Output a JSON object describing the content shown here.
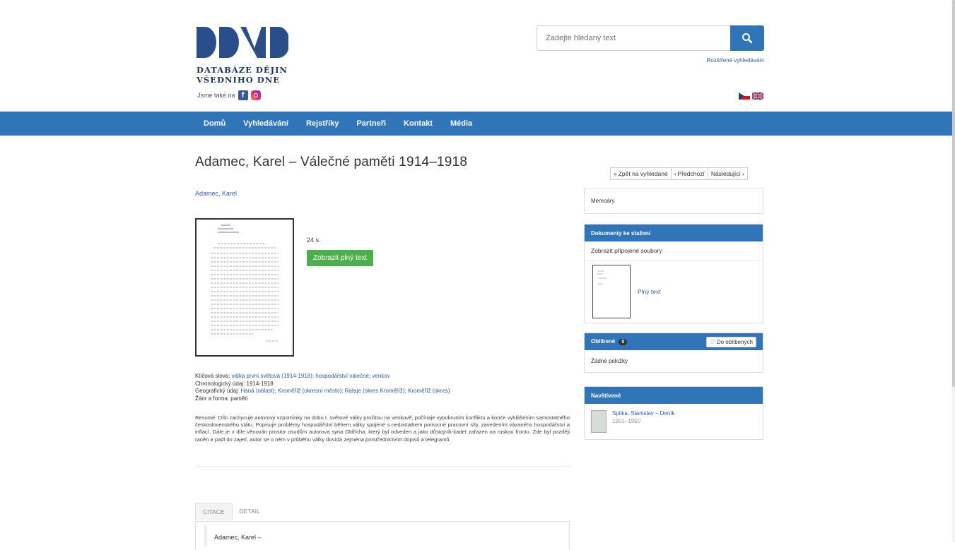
{
  "header": {
    "logo_line1": "DATABÁZE DĚJIN",
    "logo_line2": "VŠEDNÍHO DNE",
    "social_label": "Jsme také na",
    "search_placeholder": "Zadejte hledaný text",
    "advanced_search": "Rozšířené vyhledávání"
  },
  "nav": [
    "Domů",
    "Vyhledávání",
    "Rejstříky",
    "Partneři",
    "Kontakt",
    "Média"
  ],
  "record": {
    "title": "Adamec, Karel – Válečné paměti 1914–1918",
    "author": "Adamec, Karel",
    "pages": "24 s.",
    "fulltext_button": "Zobrazit plný text",
    "keywords_label": "Klíčová slova:",
    "keywords": "válka první světová (1914-1918); hospodářství válečné; venkov",
    "chronology_label": "Chronologický údaj:",
    "chronology": "1914-1918",
    "geo_label": "Geografický údaj:",
    "geo": "Haná (oblast); Kroměříž (okresní město); Rataje (okres Kroměříž); Kroměříž (okres)",
    "genre_label": "Žánr a forma:",
    "genre": "paměti",
    "resume": "Resumé: Dílo zachycuje autorovy vzpomínky na dobu I. světové války prožitou na venkově, počínaje vypuknutím konfliktu a konče vyhlášením samostatného československého státu. Popisuje problémy hospodářství během války spojené s nedostatkem pomocné pracovní síly, zavedením vázaného hospodářství a inflací. Dále je v díle věnován prostor osudům autorova syna Oldřicha, který byl odveden a jako důstojník-kadet zařazen na ruskou frontu. Zde byl později raněn a padl do zajetí, autor se o něm v průběhu války dovídá zejména prostřednictvím dopisů a telegramů."
  },
  "pager": {
    "back": "Zpět na vyhledané",
    "prev": "Předchozí",
    "next": "Následující"
  },
  "tabs": [
    "CITACE",
    "DETAIL"
  ],
  "citation": "Adamec, Karel –",
  "sidebar": {
    "category": "Memoáry",
    "downloads_title": "Dokumenty ke stažení",
    "downloads_link": "Zobrazit připojené soubory",
    "downloads_item": "Plný text",
    "favorites_title": "Oblíbené",
    "favorites_count": "0",
    "favorites_button": "Do oblíbených",
    "favorites_empty": "Žádné položky",
    "visited_title": "Navštívené",
    "visited_item_title": "Spilka, Stanislav – Deník",
    "visited_item_date": "1901–1950"
  },
  "colors": {
    "primary": "#2f75b8",
    "success": "#4cae4c",
    "link": "#2f5fa8"
  }
}
